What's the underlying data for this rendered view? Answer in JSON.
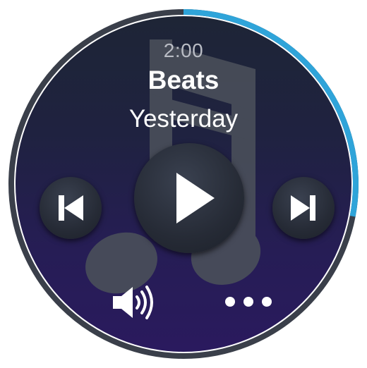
{
  "player": {
    "time": "2:00",
    "artist": "Beats",
    "track": "Yesterday",
    "progress_fraction": 0.28
  },
  "controls": {
    "previous_icon": "skip-previous-icon",
    "play_icon": "play-icon",
    "next_icon": "skip-next-icon",
    "volume_icon": "volume-icon",
    "more_icon": "more-dots-icon"
  },
  "colors": {
    "progress_ring": "#2fa4d9",
    "bezel": "#3a3f4a",
    "button_glyph": "#ffffff",
    "background_note": "#4a4f5a"
  }
}
